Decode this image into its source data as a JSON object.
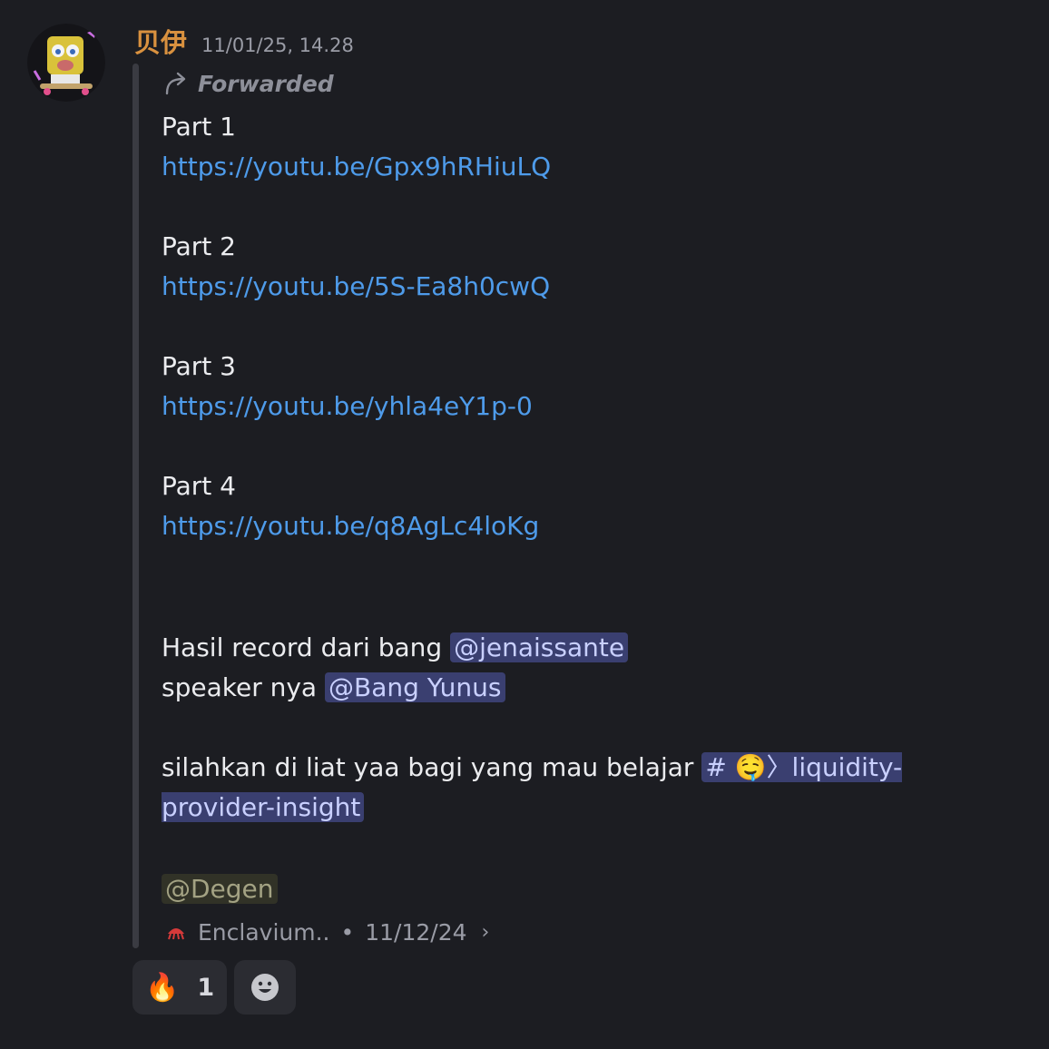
{
  "message": {
    "username": "贝伊",
    "timestamp": "11/01/25, 14.28",
    "forwarded_label": "Forwarded",
    "parts": [
      {
        "label": "Part 1",
        "url": "https://youtu.be/Gpx9hRHiuLQ"
      },
      {
        "label": "Part 2",
        "url": "https://youtu.be/5S-Ea8h0cwQ"
      },
      {
        "label": "Part 3",
        "url": "https://youtu.be/yhla4eY1p-0"
      },
      {
        "label": "Part 4",
        "url": "https://youtu.be/q8AgLc4loKg"
      }
    ],
    "line_record_prefix": "Hasil record dari bang ",
    "mention_jenaissante": "@jenaissante",
    "line_speaker_prefix": "speaker nya ",
    "mention_bang_yunus": "@Bang Yunus",
    "line_learn_prefix": "silahkan di liat yaa bagi yang mau belajar ",
    "channel_mention": "# 🤤〉liquidity-provider-insight",
    "mention_degen": "@Degen",
    "footer": {
      "server_name": "Enclavium..",
      "separator": "•",
      "date": "11/12/24",
      "chevron": "›"
    },
    "reactions": [
      {
        "emoji": "🔥",
        "count": "1"
      }
    ],
    "add_reaction_icon": "smiley-icon"
  },
  "colors": {
    "background": "#1c1d22",
    "username": "#d9913f",
    "link": "#4e9bea",
    "mention_bg": "#3a3f70",
    "mention_text": "#c9d0ff"
  }
}
